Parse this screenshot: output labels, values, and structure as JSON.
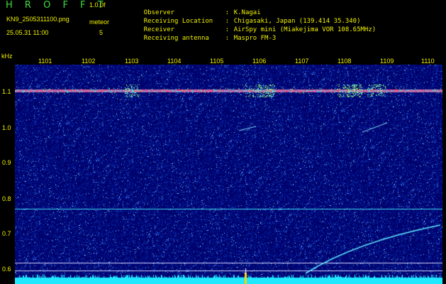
{
  "app": {
    "title": "H R O F F T",
    "version": "1.0.0f",
    "filename": "KN9_2505311100.png",
    "mode": "meteor",
    "timestamp": "25.05.31 11:00",
    "count": "5"
  },
  "info": [
    {
      "label": "Observer",
      "value": "K.Nagai"
    },
    {
      "label": "Receiving Location",
      "value": "Chigasaki, Japan (139.414 35.340)"
    },
    {
      "label": "Receiver",
      "value": "AirSpy mini (Miakejima VOR 108.65MHz)"
    },
    {
      "label": "Receiving antenna",
      "value": "Maspro FM-3"
    }
  ],
  "axis": {
    "unit_label": "kHz",
    "x_ticks": [
      "1101",
      "1102",
      "1103",
      "1104",
      "1105",
      "1106",
      "1107",
      "1108",
      "1109",
      "1110"
    ],
    "y_ticks": [
      "1.1",
      "1.0",
      "0.9",
      "0.8",
      "0.7",
      "0.6"
    ]
  },
  "colors": {
    "background": "#000000",
    "plot_bg": "#00006a",
    "label": "#f0f000",
    "title": "#3fdc3f",
    "line": "#40d8f0",
    "carrier": "#ff4080"
  }
}
